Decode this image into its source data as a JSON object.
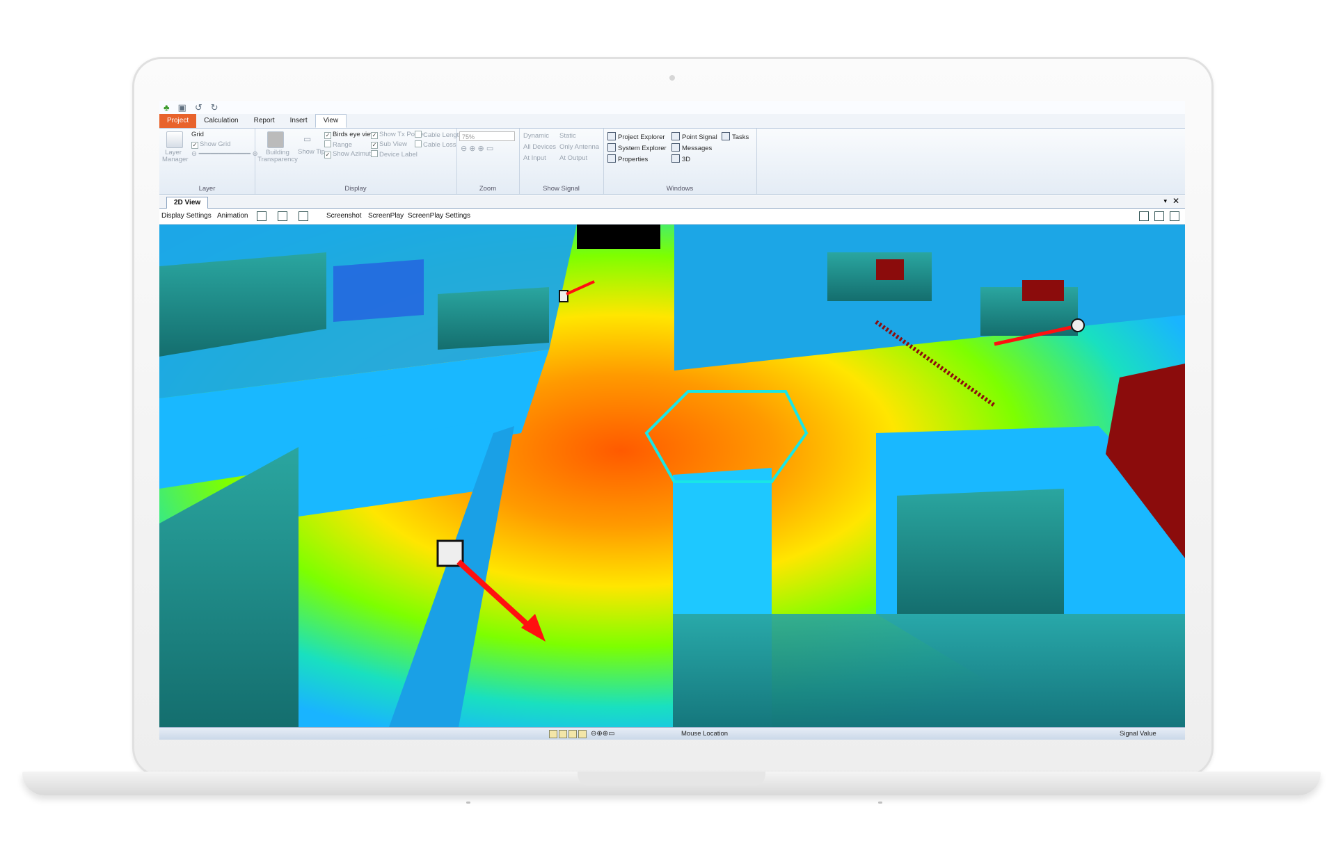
{
  "quick_access": {
    "app_icon": "app-logo-icon",
    "save_icon": "save-icon",
    "undo_icon": "undo-icon",
    "redo_icon": "redo-icon"
  },
  "ribbon_tabs": [
    "Project",
    "Calculation",
    "Report",
    "Insert",
    "View"
  ],
  "active_tab": "View",
  "ribbon": {
    "layer": {
      "label": "Layer",
      "layer_manager": "Layer Manager",
      "grid": "Grid",
      "show_grid": "Show Grid"
    },
    "display": {
      "label": "Display",
      "building_transparency": "Building Transparency",
      "show_tip": "Show Tip",
      "birds_eye_view": "Birds eye view",
      "range": "Range",
      "show_azimuth": "Show Azimuth",
      "show_tx_power": "Show Tx Power",
      "sub_view": "Sub View",
      "device_label": "Device Label",
      "cable_length": "Cable Length",
      "cable_loss": "Cable Loss"
    },
    "zoom": {
      "label": "Zoom",
      "value": "75%"
    },
    "show_signal": {
      "label": "Show Signal",
      "dynamic": "Dynamic",
      "all_devices": "All Devices",
      "at_input": "At Input",
      "static": "Static",
      "only_antenna": "Only Antenna",
      "at_output": "At Output"
    },
    "windows": {
      "label": "Windows",
      "project_explorer": "Project Explorer",
      "system_explorer": "System Explorer",
      "properties": "Properties",
      "point_signal": "Point Signal",
      "messages": "Messages",
      "three_d": "3D",
      "tasks": "Tasks"
    }
  },
  "document_tab": "2D View",
  "view_toolbar": {
    "display_settings": "Display Settings",
    "animation": "Animation",
    "screenshot": "Screenshot",
    "screenplay": "ScreenPlay",
    "screenplay_settings": "ScreenPlay Settings"
  },
  "status_bar": {
    "mouse_location": "Mouse Location",
    "signal_value": "Signal Value"
  },
  "colors": {
    "project_tab": "#e8632c",
    "heat_high": "#ff5a00",
    "heat_mid": "#ffe600",
    "heat_low": "#1ec8ff",
    "wall": "#1e8c8c",
    "arrow": "#ff1010",
    "hot_zone": "#8b0c0c"
  }
}
